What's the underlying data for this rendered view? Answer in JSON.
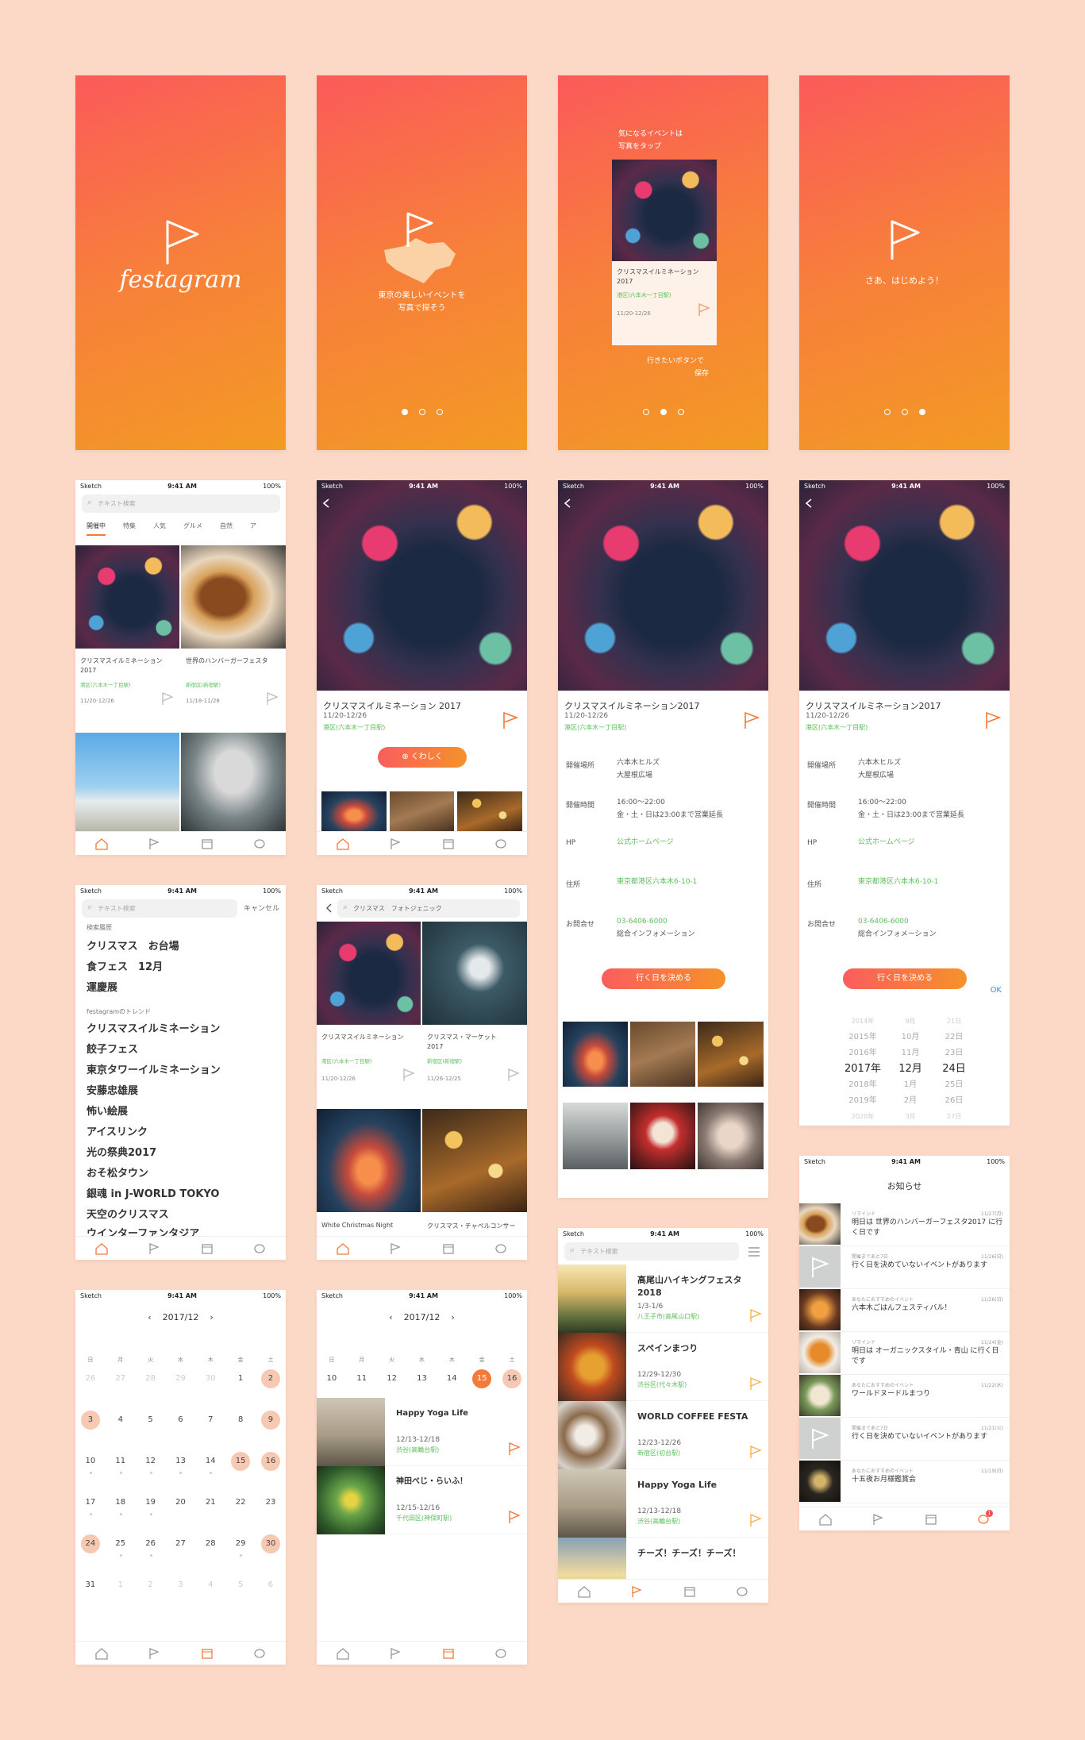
{
  "colors": {
    "bg": "#fcd9c6",
    "accent": "#f47a3a",
    "green": "#5bbf5b",
    "grad_start": "#fb5a5a",
    "grad_end": "#f39a24"
  },
  "status": {
    "carrier": "Sketch",
    "time": "9:41 AM",
    "battery": "100%"
  },
  "splash": {
    "logo_text": "festagram"
  },
  "onboarding": {
    "s2_text_1": "東京の楽しいイベントを",
    "s2_text_2": "写真で探そう",
    "s3_top_1": "気になるイベントは",
    "s3_top_2": "写真をタップ",
    "s3_card_title": "クリスマスイルミネーション2017",
    "s3_card_place": "港区(六本木一丁目駅)",
    "s3_card_date": "11/20-12/26",
    "s3_bottom_1": "行きたいボタンで",
    "s3_bottom_2": "保存",
    "s4_text": "さあ、はじめよう！"
  },
  "home": {
    "search_placeholder": "テキスト検索",
    "tabs": [
      "開催中",
      "特集",
      "人気",
      "グルメ",
      "自然",
      "ア"
    ],
    "cards": [
      {
        "title": "クリスマスイルミネーション 2017",
        "place": "港区(六本木一丁目駅)",
        "date": "11/20-12/26"
      },
      {
        "title": "世界のハンバーガーフェスタ",
        "place": "新宿区(新宿駅)",
        "date": "11/18-11/28"
      }
    ]
  },
  "detail": {
    "title": "クリスマスイルミネーション 2017",
    "title2": "クリスマスイルミネーション2017",
    "date": "11/20-12/26",
    "place": "港区(六本木一丁目駅)",
    "more_button": "くわしく",
    "rows": [
      {
        "label": "開催場所",
        "value1": "六本木ヒルズ",
        "value2": "大屋根広場"
      },
      {
        "label": "開催時間",
        "value1": "16:00〜22:00",
        "value2": "金・土・日は23:00まで営業延長"
      },
      {
        "label": "HP",
        "value1": "公式ホームページ",
        "value2": ""
      },
      {
        "label": "住所",
        "value1": "東京都港区六本木6-10-1",
        "value2": ""
      },
      {
        "label": "お問合せ",
        "value1": "03-6406-6000",
        "value2": "総合インフォメーション"
      }
    ],
    "decide_button": "行く日を決める",
    "ok": "OK",
    "picker": {
      "years": [
        "2014年",
        "2015年",
        "2016年",
        "2017年",
        "2018年",
        "2019年",
        "2020年"
      ],
      "months": [
        "9月",
        "10月",
        "11月",
        "12月",
        "1月",
        "2月",
        "3月"
      ],
      "days": [
        "21日",
        "22日",
        "23日",
        "24日",
        "25日",
        "26日",
        "27日"
      ]
    }
  },
  "search": {
    "placeholder": "テキスト検索",
    "cancel": "キャンセル",
    "history_head": "検索履歴",
    "history": [
      "クリスマス　お台場",
      "食フェス　12月",
      "運慶展"
    ],
    "trend_head": "festagramのトレンド",
    "trends": [
      "クリスマスイルミネーション",
      "餃子フェス",
      "東京タワーイルミネーション",
      "安藤忠雄展",
      "怖い絵展",
      "アイスリンク",
      "光の祭典2017",
      "おそ松タウン",
      "銀魂 in J-WORLD TOKYO",
      "天空のクリスマス",
      "ウインターファンタジア"
    ]
  },
  "results": {
    "query": "クリスマス　フォトジェニック",
    "cards": [
      {
        "title": "クリスマスイルミネーション",
        "place": "港区(六本木一丁目駅)",
        "date": "11/20-12/26"
      },
      {
        "title": "クリスマス・マーケット 2017",
        "place": "新宿区(新宿駅)",
        "date": "11/26-12/25"
      }
    ],
    "bottom_labels": [
      "White Christmas Night",
      "クリスマス・チャペルコンサー"
    ]
  },
  "calendar": {
    "month": "2017/12",
    "weekdays": [
      "日",
      "月",
      "火",
      "水",
      "木",
      "金",
      "土"
    ],
    "weeks": [
      [
        "26",
        "27",
        "28",
        "29",
        "30",
        "1",
        "2"
      ],
      [
        "3",
        "4",
        "5",
        "6",
        "7",
        "8",
        "9"
      ],
      [
        "10",
        "11",
        "12",
        "13",
        "14",
        "15",
        "16"
      ],
      [
        "17",
        "18",
        "19",
        "20",
        "21",
        "22",
        "23"
      ],
      [
        "24",
        "25",
        "26",
        "27",
        "28",
        "29",
        "30"
      ],
      [
        "31",
        "1",
        "2",
        "3",
        "4",
        "5",
        "6"
      ]
    ],
    "week_row": [
      "10",
      "11",
      "12",
      "13",
      "14",
      "15",
      "16"
    ],
    "events": [
      {
        "title": "Happy Yoga Life",
        "date": "12/13-12/18",
        "place": "渋谷(高輪台駅)"
      },
      {
        "title": "神田べじ・らいふ！",
        "date": "12/15-12/16",
        "place": "千代田区(神保町駅)"
      }
    ]
  },
  "saved": {
    "items": [
      {
        "title": "高尾山ハイキングフェスタ 2018",
        "date": "1/3-1/6",
        "place": "八王子市(高尾山口駅)"
      },
      {
        "title": "スペインまつり",
        "date": "12/29-12/30",
        "place": "渋谷区(代々木駅)"
      },
      {
        "title": "WORLD COFFEE FESTA",
        "date": "12/23-12/26",
        "place": "新宿区(初台駅)"
      },
      {
        "title": "Happy Yoga Life",
        "date": "12/13-12/18",
        "place": "渋谷(高輪台駅)"
      },
      {
        "title": "チーズ！チーズ！チーズ！",
        "date": "",
        "place": ""
      }
    ]
  },
  "notifications": {
    "title": "お知らせ",
    "items": [
      {
        "small": "リマインド",
        "date": "11/27(月)",
        "msg": "明日は 世界のハンバーガーフェスタ2017 に行く日です"
      },
      {
        "small": "開催まであと7日",
        "date": "11/26(日)",
        "msg": "行く日を決めていないイベントがあります"
      },
      {
        "small": "あなたにおすすめのイベント",
        "date": "11/26(日)",
        "msg": "六本木ごはんフェスティバル！"
      },
      {
        "small": "リマインド",
        "date": "11/24(金)",
        "msg": "明日は オーガニックスタイル・青山 に行く日です"
      },
      {
        "small": "あなたにおすすめのイベント",
        "date": "11/22(水)",
        "msg": "ワールドヌードルまつり"
      },
      {
        "small": "開催まであと7日",
        "date": "11/21(火)",
        "msg": "行く日を決めていないイベントがあります"
      },
      {
        "small": "あなたにおすすめのイベント",
        "date": "11/19(日)",
        "msg": "十五夜お月様鑑賞会"
      }
    ],
    "badge": "1"
  }
}
